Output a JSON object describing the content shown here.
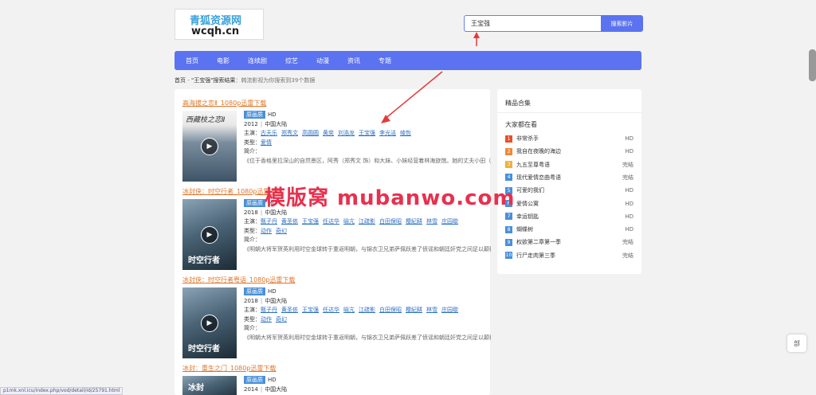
{
  "logo": {
    "line1": "青狐资源网",
    "line2": "wcqh.cn"
  },
  "search": {
    "value": "王宝强",
    "button": "搜索影片"
  },
  "nav": [
    "首页",
    "电影",
    "连续剧",
    "综艺",
    "动漫",
    "资讯",
    "专题"
  ],
  "breadcrumb": {
    "home": "首页",
    "sep": " - ",
    "query": "\"王宝强\"搜索结果",
    "sep2": "：",
    "result": "韩流影视为你搜索到39个数据"
  },
  "results": [
    {
      "title": "高海拔之恋Ⅱ_1080p迅雷下载",
      "poster_text": "西藏枝之恋Ⅱ",
      "tag": "原画质",
      "quality": "HD",
      "year": "2012",
      "region": "中国大陆",
      "cast_label": "主演：",
      "cast": [
        "古天乐",
        "郑秀文",
        "高圆圆",
        "黄奕",
        "刘浩龙",
        "王宝强",
        "李光洁",
        "绫哲"
      ],
      "genre_label": "类型：",
      "genres": [
        "爱情"
      ],
      "intro_label": "简介：",
      "desc": "《位于香格里拉深山的自然景区，阿秀（郑秀文 饰）和大妹、小妹经营着林海旅馆。她的丈夫小田（李光洁 饰）七年前误入林海，生死不明。但阿秀始终没有放弃寻找的希望。"
    },
    {
      "title": "冰封侠：时空行者_1080p迅雷下载",
      "poster_text": "时空行者",
      "tag": "原画质",
      "quality": "HD",
      "year": "2018",
      "region": "中国大陆",
      "cast_label": "主演：",
      "cast": [
        "甄子丹",
        "黄圣依",
        "王宝强",
        "任达华",
        "喻亢",
        "江疏影",
        "白田保昭",
        "樱紀耕",
        "林雪",
        "庄园歇"
      ],
      "genre_label": "类型：",
      "genres": [
        "动作",
        "奇幻"
      ],
      "intro_label": "简介：",
      "desc": "《明朝大将军贺英利用时空金球转于重返明朝，与锦衣卫兄弟萨佩跃差了偾谣和朝廷奸党之间足以颠覆皇权的密谋。牌延400年的佟天危机一触即发。贺英也在扫朗知己小美的帮助下"
    },
    {
      "title": "冰封侠：时空行者粤语_1080p迅雷下载",
      "poster_text": "时空行者",
      "tag": "原画质",
      "quality": "HD",
      "year": "2018",
      "region": "中国大陆",
      "cast_label": "主演：",
      "cast": [
        "甄子丹",
        "黄圣依",
        "王宝强",
        "任达华",
        "喻亢",
        "江疏影",
        "白田保昭",
        "樱紀耕",
        "林雪",
        "庄园歇"
      ],
      "genre_label": "类型：",
      "genres": [
        "动作",
        "奇幻"
      ],
      "intro_label": "简介：",
      "desc": "《明朝大将军贺英利用时空金球转于重返明朝，与锦衣卫兄弟萨佩跃差了偾谣和朝廷奸党之间足以颠覆皇权的密谋。牌延400年的佟天危机一触即发。贺英也在扫朗知己小美的帮助下"
    },
    {
      "title": "冰封：重生之门_1080p迅雷下载",
      "poster_text": "冰封",
      "tag": "原画质",
      "quality": "HD",
      "year": "2014",
      "region": "中国大陆"
    }
  ],
  "sidebar": {
    "title": "精品合集",
    "subtitle": "大家都在看",
    "items": [
      {
        "n": "1",
        "title": "非常杀手",
        "q": "HD",
        "color": "#e8502a"
      },
      {
        "n": "2",
        "title": "我自在夜晚的海边",
        "q": "HD",
        "color": "#f0883a"
      },
      {
        "n": "3",
        "title": "九五至尊粤语",
        "q": "完结",
        "color": "#f2b03c"
      },
      {
        "n": "4",
        "title": "现代爱情恋曲粤语",
        "q": "完结",
        "color": "#4a90d9"
      },
      {
        "n": "5",
        "title": "可爱的我们",
        "q": "HD",
        "color": "#4a90d9"
      },
      {
        "n": "6",
        "title": "爱情公寓",
        "q": "HD",
        "color": "#4a90d9"
      },
      {
        "n": "7",
        "title": "幸运钥匙",
        "q": "HD",
        "color": "#4a90d9"
      },
      {
        "n": "8",
        "title": "蝴蝶树",
        "q": "HD",
        "color": "#4a90d9"
      },
      {
        "n": "9",
        "title": "权欲第二章第一季",
        "q": "完结",
        "color": "#4a90d9"
      },
      {
        "n": "10",
        "title": "行尸走肉第三季",
        "q": "完结",
        "color": "#4a90d9"
      }
    ]
  },
  "status_url": "p1mk.xnl.icu/index.php/vod/detail/id/25791.html",
  "watermark": "模版窝 mubanwo.com",
  "float_btn": "部"
}
